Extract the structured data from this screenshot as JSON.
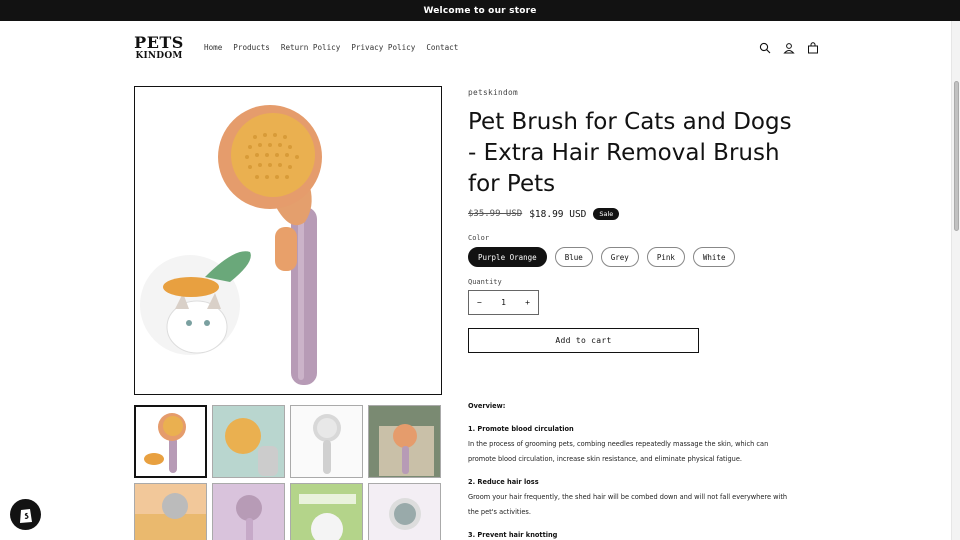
{
  "announcement": "Welcome to our store",
  "logo": {
    "line1": "PETS",
    "line2": "KINDOM"
  },
  "nav": [
    "Home",
    "Products",
    "Return Policy",
    "Privacy Policy",
    "Contact"
  ],
  "header_icons": [
    "search-icon",
    "account-icon",
    "cart-icon"
  ],
  "product": {
    "vendor": "petskindom",
    "title": "Pet Brush for Cats and Dogs - Extra Hair Removal Brush for Pets",
    "price_old": "$35.99 USD",
    "price_new": "$18.99 USD",
    "badge": "Sale",
    "color_label": "Color",
    "colors": [
      "Purple Orange",
      "Blue",
      "Grey",
      "Pink",
      "White"
    ],
    "selected_color": "Purple Orange",
    "quantity_label": "Quantity",
    "quantity": "1",
    "minus": "−",
    "plus": "+",
    "add_to_cart": "Add to cart"
  },
  "description": {
    "overview": "Overview:",
    "items": [
      {
        "heading": "1. Promote blood circulation",
        "text": "In the process of grooming pets, combing needles repeatedly massage the skin, which can promote blood circulation, increase skin resistance, and eliminate physical fatigue."
      },
      {
        "heading": "2. Reduce hair loss",
        "text": "Groom your hair frequently, the shed hair will be combed down and will not fall everywhere with the pet's activities."
      },
      {
        "heading": "3. Prevent hair knotting",
        "text": ""
      }
    ]
  },
  "colors": {
    "dark": "#121212",
    "brush_orange": "#e8a06a",
    "brush_purple": "#b89ab8",
    "bristle_yellow": "#e8b64a"
  }
}
